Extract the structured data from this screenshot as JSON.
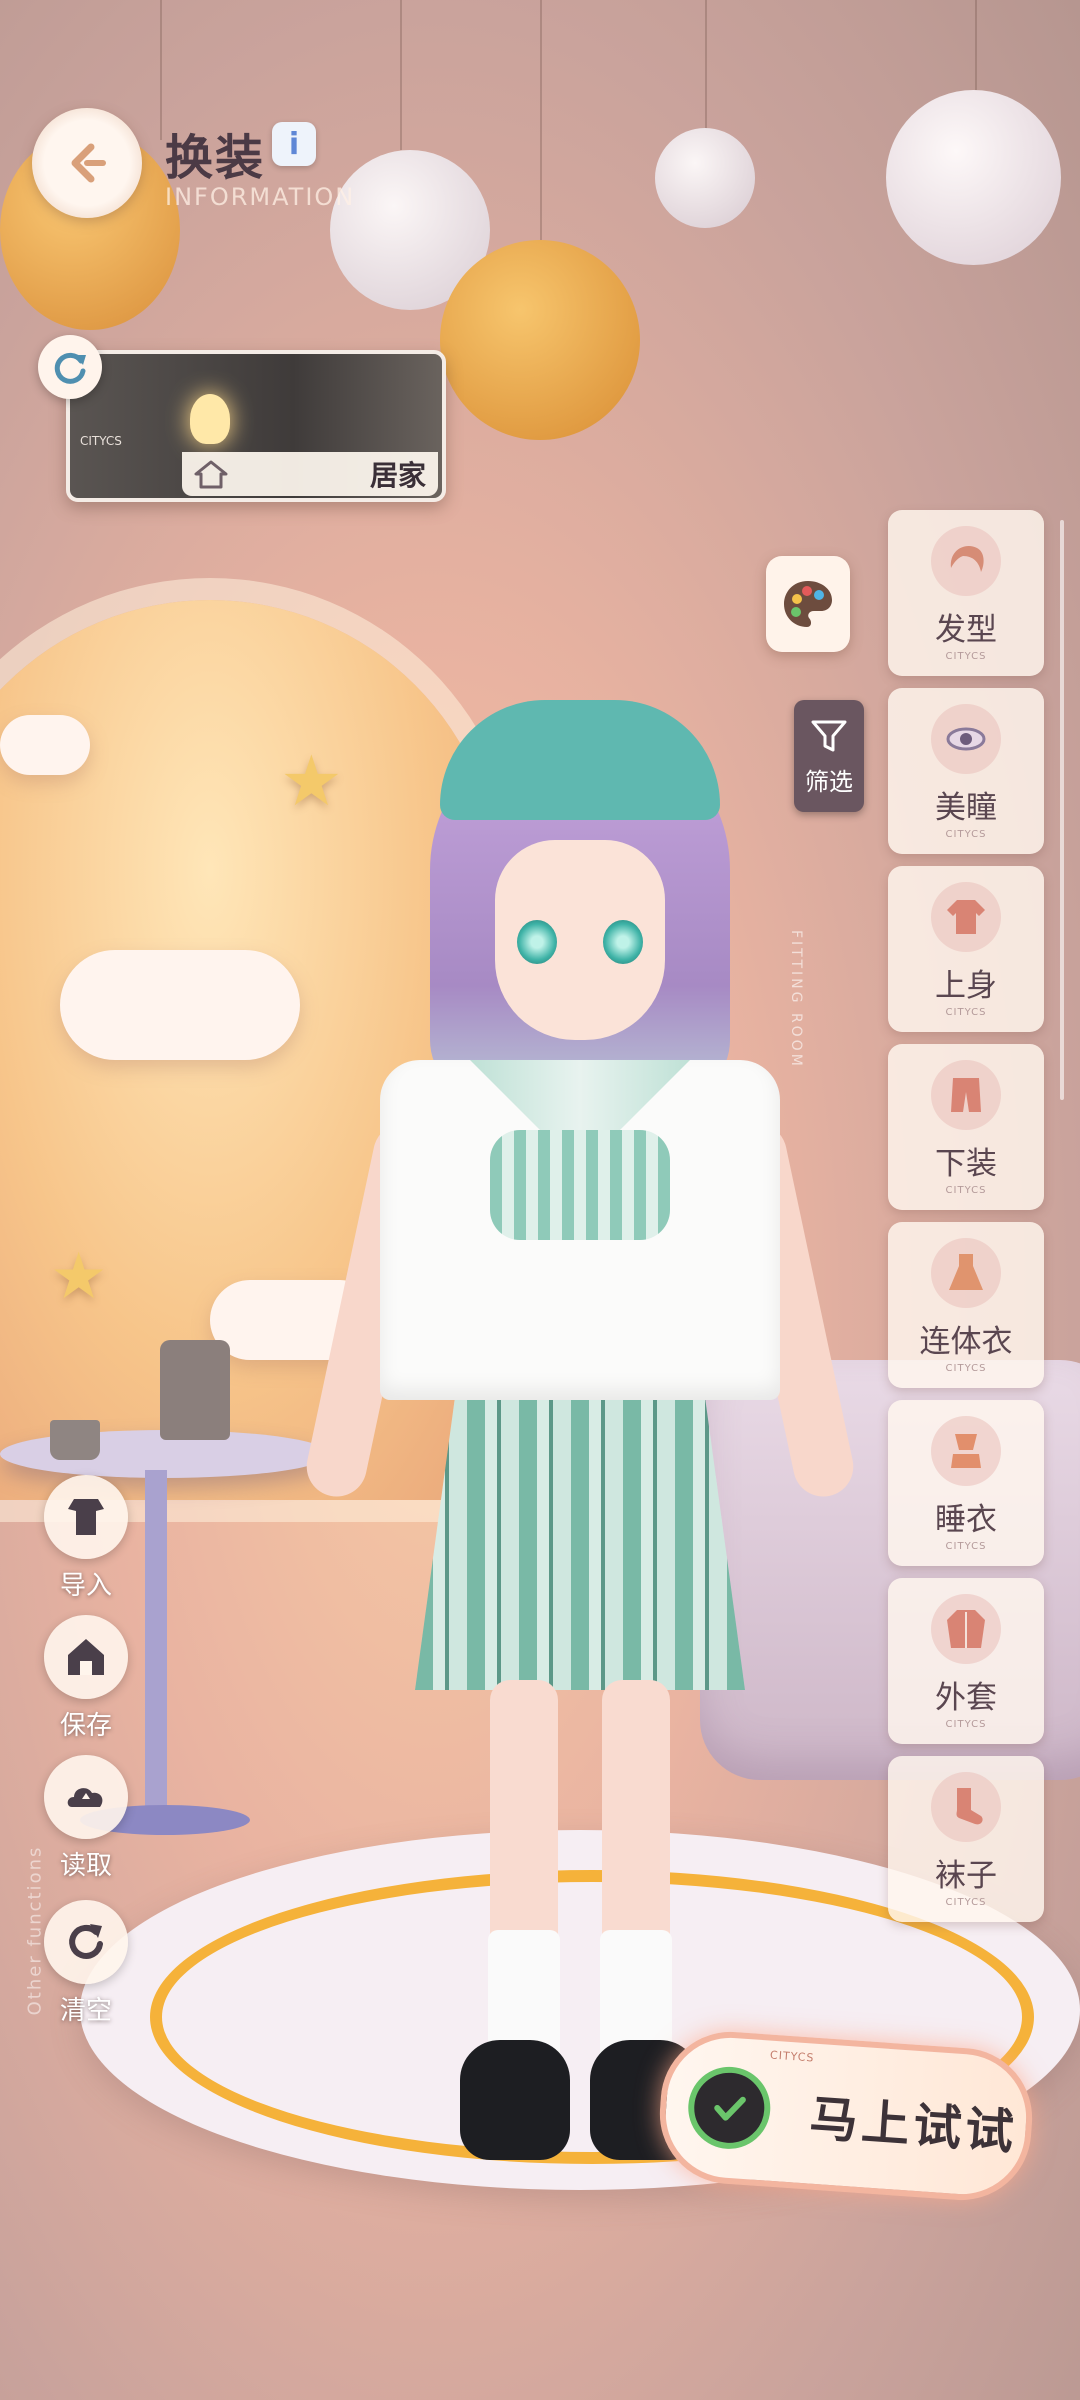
{
  "header": {
    "title": "换装",
    "subtitle": "INFORMATION",
    "info_icon": "i"
  },
  "scene": {
    "name": "居家",
    "tag": "CITYCS"
  },
  "filter": {
    "label": "筛选",
    "vertical_text": "FITTING ROOM"
  },
  "categories": [
    {
      "label": "发型",
      "icon": "hair-icon",
      "sub": "CITYCS"
    },
    {
      "label": "美瞳",
      "icon": "eye-icon",
      "sub": "CITYCS"
    },
    {
      "label": "上身",
      "icon": "shirt-icon",
      "sub": "CITYCS"
    },
    {
      "label": "下装",
      "icon": "pants-icon",
      "sub": "CITYCS"
    },
    {
      "label": "连体衣",
      "icon": "dress-icon",
      "sub": "CITYCS"
    },
    {
      "label": "睡衣",
      "icon": "pajamas-icon",
      "sub": "CITYCS"
    },
    {
      "label": "外套",
      "icon": "coat-icon",
      "sub": "CITYCS"
    },
    {
      "label": "袜子",
      "icon": "sock-icon",
      "sub": "CITYCS"
    }
  ],
  "actions": [
    {
      "label": "导入",
      "icon": "import-icon"
    },
    {
      "label": "保存",
      "icon": "save-icon"
    },
    {
      "label": "读取",
      "icon": "load-icon"
    },
    {
      "label": "清空",
      "icon": "clear-icon"
    }
  ],
  "left_vertical_text": "Other functions",
  "try_button": {
    "label": "马上试试",
    "tag": "CITYCS"
  },
  "colors": {
    "accent": "#5fb8b0",
    "check": "#6ac56b",
    "glow": "#f3b59f"
  }
}
